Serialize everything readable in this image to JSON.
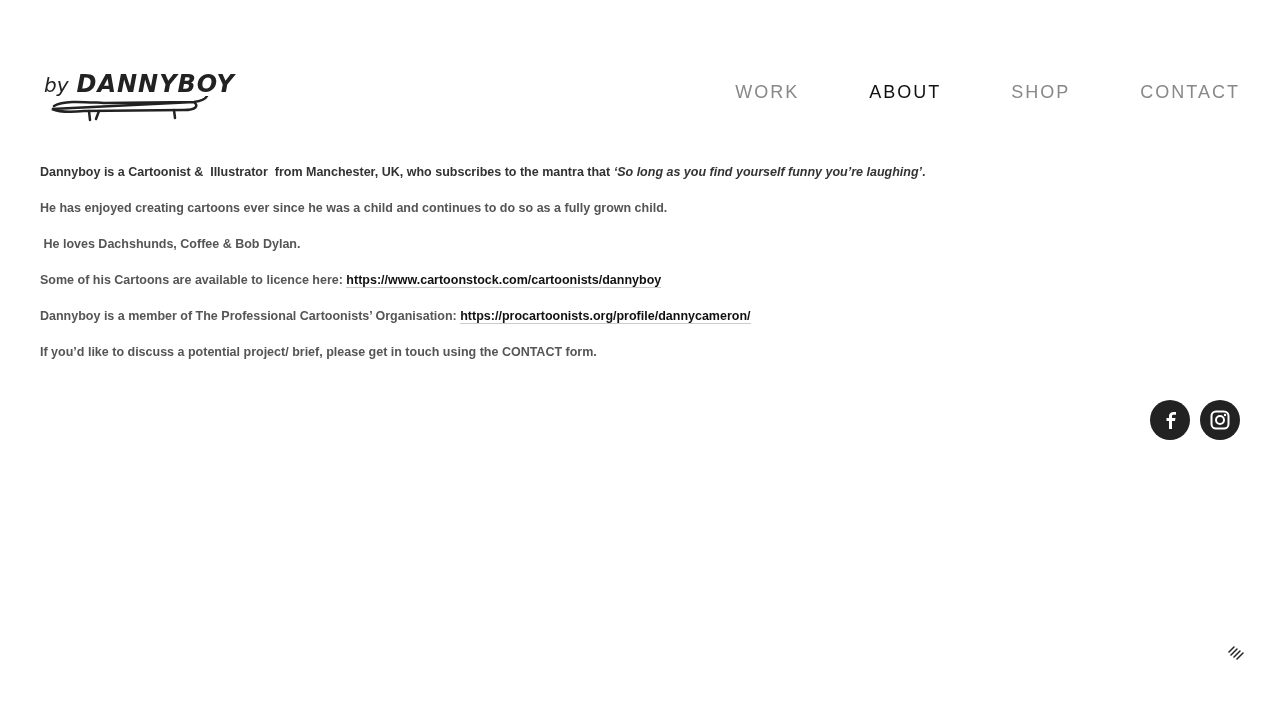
{
  "logo": {
    "prefix": "by",
    "name": "DANNYBOY"
  },
  "nav": [
    {
      "label": "WORK",
      "selected": false
    },
    {
      "label": "ABOUT",
      "selected": true
    },
    {
      "label": "SHOP",
      "selected": false
    },
    {
      "label": "CONTACT",
      "selected": false
    }
  ],
  "paragraphs": [
    {
      "kind": "strong",
      "text": "Dannyboy is a Cartoonist &  Illustrator  from Manchester, UK, who subscribes to the mantra that *‘So long as you find yourself funny you’re laughing’*."
    },
    {
      "kind": "plain",
      "text": "He has enjoyed creating cartoons ever since he was a child and continues to do so as a fully grown child."
    },
    {
      "kind": "plain",
      "text": " He loves Dachshunds, Coffee & Bob Dylan."
    },
    {
      "kind": "plain",
      "text": "Some of his Cartoons are available to licence here: ",
      "link": "https://www.cartoonstock.com/cartoonists/dannyboy"
    },
    {
      "kind": "plain",
      "text": "Dannyboy is a member of The Professional Cartoonists’ Organisation: ",
      "link": "https://procartoonists.org/profile/dannycameron/"
    },
    {
      "kind": "plain",
      "text": "If you’d like to discuss a potential project/ brief, please get in touch using the CONTACT form."
    }
  ],
  "social": [
    {
      "kind": "facebook"
    },
    {
      "kind": "instagram"
    }
  ]
}
